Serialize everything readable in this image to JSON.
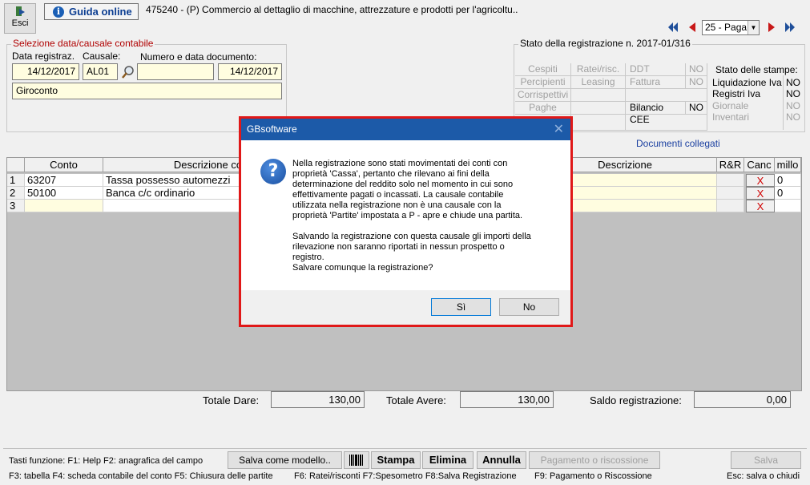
{
  "toolbar": {
    "esci_label": "Esci",
    "guida_label": "Guida online",
    "title": "475240 - (P) Commercio al dettaglio di macchine, attrezzature e prodotti per l'agricoltu.."
  },
  "nav": {
    "page_select": "25 - Paga"
  },
  "selezione": {
    "legend": "Selezione data/causale contabile",
    "data_label": "Data registraz.",
    "causale_label": "Causale:",
    "numdoc_label": "Numero e data documento:",
    "data_value": "14/12/2017",
    "causale_value": "AL01",
    "numdoc_value": "",
    "datadoc_value": "14/12/2017",
    "descrizione_value": "Giroconto"
  },
  "stato": {
    "legend": "Stato della registrazione n. 2017-01/316",
    "cespiti": "Cespiti",
    "ratei": "Ratei/risc.",
    "ddt": "DDT",
    "ddt_val": "NO",
    "percipienti": "Percipienti",
    "leasing": "Leasing",
    "fattura": "Fattura",
    "fattura_val": "NO",
    "corrispettivi": "Corrispettivi",
    "paghe": "Paghe",
    "bilancio": "Bilancio CEE",
    "bilancio_val": "NO",
    "stampe_title": "Stato delle stampe:",
    "liquidazione": "Liquidazione Iva",
    "liquidazione_val": "NO",
    "registri": "Registri Iva",
    "registri_val": "NO",
    "giornale": "Giornale",
    "giornale_val": "NO",
    "inventari": "Inventari",
    "inventari_val": "NO"
  },
  "documenti_collegati": "Documenti collegati",
  "grid": {
    "headers": {
      "conto": "Conto",
      "descrizione_conto": "Descrizione conto",
      "descrizione": "Descrizione",
      "rr": "R&R",
      "canc": "Canc",
      "millo": "millo"
    },
    "rows": [
      {
        "n": "1",
        "conto": "63207",
        "descr": "Tassa possesso automezzi",
        "canc": "X",
        "millo": "0"
      },
      {
        "n": "2",
        "conto": "50100",
        "descr": "Banca c/c ordinario",
        "canc": "X",
        "millo": "0"
      },
      {
        "n": "3",
        "conto": "",
        "descr": "",
        "canc": "X",
        "millo": ""
      }
    ]
  },
  "totals": {
    "dare_label": "Totale Dare:",
    "dare_value": "130,00",
    "avere_label": "Totale Avere:",
    "avere_value": "130,00",
    "saldo_label": "Saldo registrazione:",
    "saldo_value": "0,00"
  },
  "bottom": {
    "keys1": "Tasti funzione: F1: Help  F2: anagrafica del campo",
    "salva_modello": "Salva come modello..",
    "stampa": "Stampa",
    "elimina": "Elimina",
    "annulla": "Annulla",
    "pagamento": "Pagamento o riscossione",
    "salva": "Salva",
    "keys2": "F3: tabella   F4: scheda contabile del conto  F5: Chiusura delle partite",
    "keys3": "F6: Ratei/risconti  F7:Spesometro  F8:Salva Registrazione",
    "keys4": "F9: Pagamento o Riscossione",
    "keys5": "Esc: salva o chiudi"
  },
  "dialog": {
    "title": "GBsoftware",
    "message": "Nella registrazione sono stati movimentati dei conti con\nproprietà 'Cassa', pertanto che rilevano ai fini della\ndeterminazione del reddito solo nel momento in cui sono\neffettivamente pagati o incassati. La causale contabile\nutilizzata nella registrazione non è una causale con la\nproprietà 'Partite' impostata a P - apre e chiude una partita.\n\nSalvando la registrazione con questa causale gli importi della\nrilevazione non saranno riportati in nessun prospetto o\nregistro.\nSalvare comunque la registrazione?",
    "yes": "Sì",
    "no": "No"
  }
}
